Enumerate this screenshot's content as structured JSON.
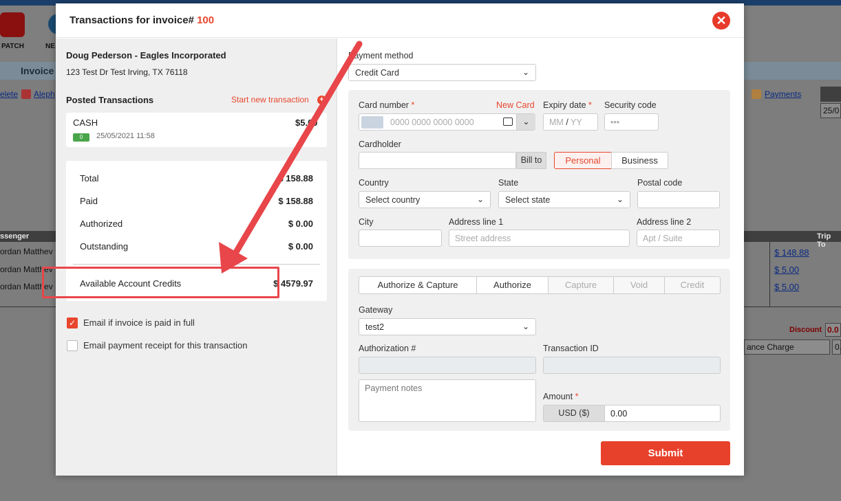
{
  "background": {
    "toolbar_items": [
      "PATCH",
      "NE"
    ],
    "invoice_label": "Invoice",
    "links": [
      "elete",
      "Aleph",
      "Payments"
    ],
    "date_partial": "25/0",
    "table_headers": [
      "ssenger",
      "Trip To"
    ],
    "rows": [
      "ordan Matthev",
      "ordan Matthev",
      "ordan Matthev"
    ],
    "trip_totals": [
      "$ 148.88",
      "$ 5.00",
      "$ 5.00"
    ],
    "discount_label": "Discount",
    "discount_value": "0.0",
    "finance_charge": "ance Charge",
    "finance_value": "0."
  },
  "modal": {
    "title": "Transactions for invoice#",
    "invoice_number": "100",
    "close_icon": "close-icon"
  },
  "left": {
    "customer_name": "Doug Pederson - Eagles Incorporated",
    "customer_address": "123 Test Dr Test Irving, TX 76118",
    "posted_title": "Posted Transactions",
    "start_new": "Start new transaction",
    "transaction": {
      "type": "CASH",
      "amount": "$5.00",
      "date": "25/05/2021 11:58"
    },
    "totals": [
      {
        "label": "Total",
        "value": "$ 158.88"
      },
      {
        "label": "Paid",
        "value": "$ 158.88"
      },
      {
        "label": "Authorized",
        "value": "$ 0.00"
      },
      {
        "label": "Outstanding",
        "value": "$ 0.00"
      }
    ],
    "credits_label": "Available Account Credits",
    "credits_value": "$ 4579.97",
    "email_paid_full": {
      "label": "Email if invoice is paid in full",
      "checked": true
    },
    "email_receipt": {
      "label": "Email payment receipt for this transaction",
      "checked": false
    }
  },
  "right": {
    "payment_method_label": "Payment method",
    "payment_method_value": "Credit Card",
    "card_number_label": "Card number",
    "required_mark": "*",
    "new_card": "New Card",
    "card_placeholder": "0000 0000 0000 0000",
    "expiry_label": "Expiry date",
    "expiry_mm": "MM",
    "expiry_sep": "/",
    "expiry_yy": "YY",
    "security_label": "Security code",
    "security_placeholder": "•••",
    "cardholder_label": "Cardholder",
    "bill_to": "Bill to",
    "personal": "Personal",
    "business": "Business",
    "country_label": "Country",
    "country_value": "Select country",
    "state_label": "State",
    "state_value": "Select state",
    "postal_label": "Postal code",
    "city_label": "City",
    "address1_label": "Address line 1",
    "address1_placeholder": "Street address",
    "address2_label": "Address line 2",
    "address2_placeholder": "Apt / Suite",
    "tabs": [
      {
        "label": "Authorize & Capture",
        "enabled": true
      },
      {
        "label": "Authorize",
        "enabled": true
      },
      {
        "label": "Capture",
        "enabled": false
      },
      {
        "label": "Void",
        "enabled": false
      },
      {
        "label": "Credit",
        "enabled": false
      }
    ],
    "gateway_label": "Gateway",
    "gateway_value": "test2",
    "auth_label": "Authorization #",
    "txn_id_label": "Transaction ID",
    "notes_placeholder": "Payment notes",
    "amount_label": "Amount",
    "currency": "USD ($)",
    "amount_value": "0.00",
    "submit": "Submit"
  },
  "colors": {
    "accent": "#e8462d",
    "annotation": "#e8464a"
  }
}
